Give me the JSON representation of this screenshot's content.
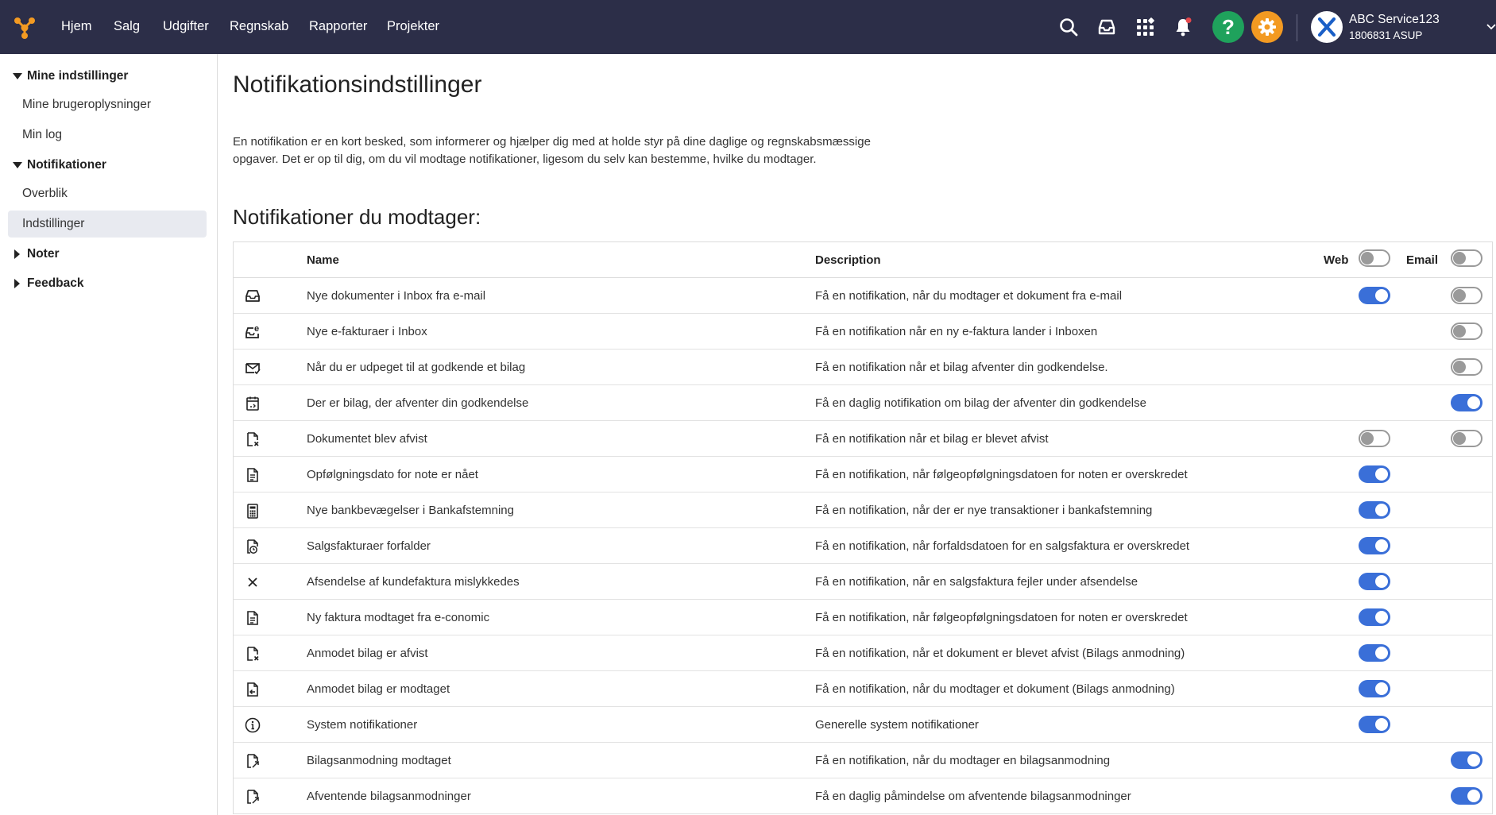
{
  "topnav": {
    "items": [
      "Hjem",
      "Salg",
      "Udgifter",
      "Regnskab",
      "Rapporter",
      "Projekter"
    ],
    "help_label": "?",
    "account": {
      "name": "ABC Service123",
      "id": "1806831 ASUP"
    }
  },
  "sidebar": {
    "sections": [
      {
        "label": "Mine indstillinger",
        "expanded": true,
        "items": [
          "Mine brugeroplysninger",
          "Min log"
        ]
      },
      {
        "label": "Notifikationer",
        "expanded": true,
        "items": [
          "Overblik",
          "Indstillinger"
        ],
        "active": "Indstillinger"
      },
      {
        "label": "Noter",
        "expanded": false,
        "items": []
      },
      {
        "label": "Feedback",
        "expanded": false,
        "items": []
      }
    ]
  },
  "main": {
    "title": "Notifikationsindstillinger",
    "intro": "En notifikation er en kort besked, som informerer og hjælper dig med at holde styr på dine daglige og regnskabsmæssige opgaver. Det er op til dig, om du vil modtage notifikationer, ligesom du selv kan bestemme, hvilke du modtager.",
    "section_title": "Notifikationer du modtager:",
    "table": {
      "headers": {
        "name": "Name",
        "description": "Description",
        "web": "Web",
        "email": "Email"
      },
      "rows": [
        {
          "icon": "inbox-icon",
          "name": "Nye dokumenter i Inbox fra e-mail",
          "description": "Få en notifikation, når du modtager et dokument fra e-mail",
          "web": "on",
          "email": "off"
        },
        {
          "icon": "e-invoice-icon",
          "name": "Nye e-fakturaer i Inbox",
          "description": "Få en notifikation når en ny e-faktura lander i Inboxen",
          "web": "none",
          "email": "off"
        },
        {
          "icon": "envelope-check-icon",
          "name": "Når du er udpeget til at godkende et bilag",
          "description": "Få en notifikation når et bilag afventer din godkendelse.",
          "web": "none",
          "email": "off"
        },
        {
          "icon": "calendar-approval-icon",
          "name": "Der er bilag, der afventer din godkendelse",
          "description": "Få en daglig notifikation om bilag der afventer din godkendelse",
          "web": "none",
          "email": "on"
        },
        {
          "icon": "document-x-icon",
          "name": "Dokumentet blev afvist",
          "description": "Få en notifikation når et bilag er blevet afvist",
          "web": "off",
          "email": "off"
        },
        {
          "icon": "document-lines-icon",
          "name": "Opfølgningsdato for note er nået",
          "description": "Få en notifikation, når følgeopfølgningsdatoen for noten er overskredet",
          "web": "on",
          "email": "none"
        },
        {
          "icon": "calculator-icon",
          "name": "Nye bankbevægelser i Bankafstemning",
          "description": "Få en notifikation, når der er nye transaktioner i bankafstemning",
          "web": "on",
          "email": "none"
        },
        {
          "icon": "document-clock-icon",
          "name": "Salgsfakturaer forfalder",
          "description": "Få en notifikation, når forfaldsdatoen for en salgsfaktura er overskredet",
          "web": "on",
          "email": "none"
        },
        {
          "icon": "close-x-icon",
          "name": "Afsendelse af kundefaktura mislykkedes",
          "description": "Få en notifikation, når en salgsfaktura fejler under afsendelse",
          "web": "on",
          "email": "none"
        },
        {
          "icon": "document-lines-icon",
          "name": "Ny faktura modtaget fra e-conomic",
          "description": "Få en notifikation, når følgeopfølgningsdatoen for noten er overskredet",
          "web": "on",
          "email": "none"
        },
        {
          "icon": "document-x-icon",
          "name": "Anmodet bilag er afvist",
          "description": "Få en notifikation, når et dokument er blevet afvist (Bilags anmodning)",
          "web": "on",
          "email": "none"
        },
        {
          "icon": "document-arrow-icon",
          "name": "Anmodet bilag er modtaget",
          "description": "Få en notifikation, når du modtager et dokument (Bilags anmodning)",
          "web": "on",
          "email": "none"
        },
        {
          "icon": "info-circle-icon",
          "name": "System notifikationer",
          "description": "Generelle system notifikationer",
          "web": "on",
          "email": "none"
        },
        {
          "icon": "document-share-icon",
          "name": "Bilagsanmodning modtaget",
          "description": "Få en notifikation, når du modtager en bilagsanmodning",
          "web": "none",
          "email": "on"
        },
        {
          "icon": "document-share-icon",
          "name": "Afventende bilagsanmodninger",
          "description": "Få en daglig påmindelse om afventende bilagsanmodninger",
          "web": "none",
          "email": "on"
        }
      ]
    }
  },
  "colors": {
    "topbar": "#2c2e48",
    "toggle_on": "#3a6fd8",
    "help": "#1fa25c",
    "settings": "#f39a22",
    "logo": "#f39a22"
  }
}
